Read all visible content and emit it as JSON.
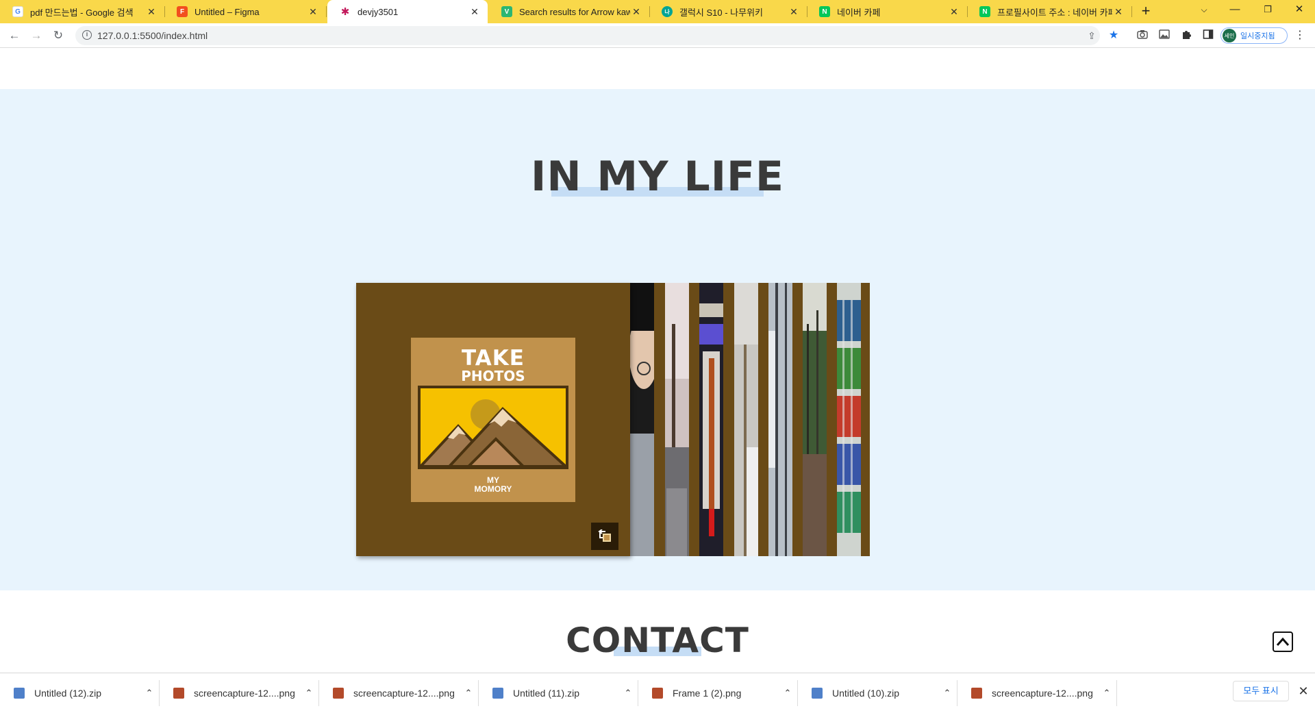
{
  "browser": {
    "tabs": [
      {
        "title": "pdf 만드는법 - Google 검색",
        "icon": "google-icon",
        "color": "#4285f4",
        "letter": "G"
      },
      {
        "title": "Untitled – Figma",
        "icon": "figma-icon",
        "color": "#f24e1e",
        "letter": "F"
      },
      {
        "title": "devjy3501",
        "icon": "asterisk-icon",
        "color": "#c2185b",
        "letter": "✱"
      },
      {
        "title": "Search results for Arrow kawaii",
        "icon": "vectorstock-icon",
        "color": "#2bb673",
        "letter": "V"
      },
      {
        "title": "갤럭시 S10 - 나무위키",
        "icon": "namuwiki-icon",
        "color": "#00a495",
        "letter": "나"
      },
      {
        "title": "네이버 카페",
        "icon": "naver-cafe-icon",
        "color": "#03c75a",
        "letter": "N"
      },
      {
        "title": "프로필사이트 주소 : 네이버 카페",
        "icon": "naver-cafe-icon",
        "color": "#03c75a",
        "letter": "N"
      }
    ],
    "url": "127.0.0.1:5500/index.html",
    "profile_label": "일시중지됨",
    "profile_avatar": "세인"
  },
  "page": {
    "life_heading": "IN MY LIFE",
    "contact_heading": "CONTACT",
    "poster": {
      "title_line1": "TAKE",
      "title_line2": "PHOTOS",
      "caption_line1": "MY",
      "caption_line2": "MOMORY"
    },
    "colors": {
      "section_bg": "#e8f4fd",
      "gallery_brown": "#6a4b17",
      "poster_tan": "#c1924c",
      "poster_yellow": "#f6c100"
    }
  },
  "downloads": {
    "items": [
      {
        "name": "Untitled (12).zip",
        "type": "zip"
      },
      {
        "name": "screencapture-12....png",
        "type": "png"
      },
      {
        "name": "screencapture-12....png",
        "type": "png"
      },
      {
        "name": "Untitled (11).zip",
        "type": "zip"
      },
      {
        "name": "Frame 1 (2).png",
        "type": "png"
      },
      {
        "name": "Untitled (10).zip",
        "type": "zip"
      },
      {
        "name": "screencapture-12....png",
        "type": "png"
      }
    ],
    "show_all": "모두 표시"
  }
}
